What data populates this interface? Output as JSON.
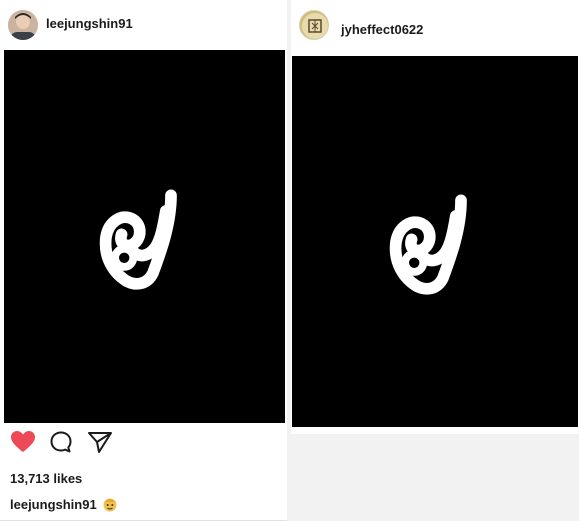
{
  "posts": [
    {
      "username": "leejungshin91",
      "image_glyph": "๙",
      "likes": "13,713 likes",
      "caption_user": "leejungshin91",
      "liked": true
    },
    {
      "username": "jyheffect0622",
      "image_glyph": "๙"
    }
  ],
  "colors": {
    "heart": "#ed4956",
    "image_bg": "#000000",
    "glyph": "#ffffff",
    "text": "#1b1b1b"
  },
  "icons": [
    "heart-icon",
    "comment-icon",
    "share-icon",
    "avatar",
    "emoji-icon"
  ]
}
